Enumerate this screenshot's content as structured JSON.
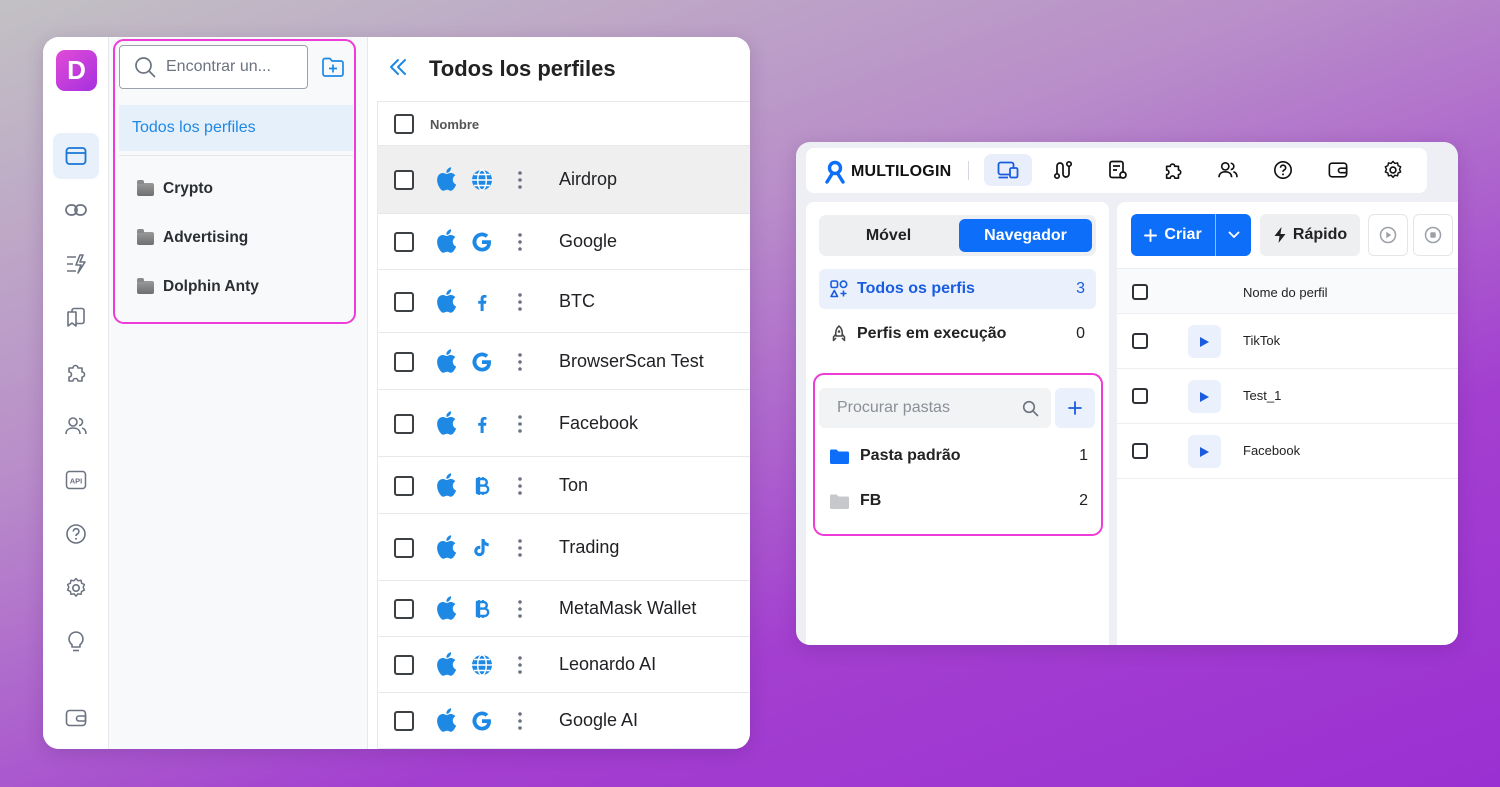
{
  "dolphin": {
    "logo_letter": "D",
    "search_placeholder": "Encontrar un...",
    "all_profiles_label": "Todos los perfiles",
    "folders": [
      "Crypto",
      "Advertising",
      "Dolphin Anty"
    ],
    "page_title": "Todos los perfiles",
    "column_name": "Nombre",
    "profiles": [
      {
        "name": "Airdrop",
        "site_icon": "globe-icon",
        "selected": true
      },
      {
        "name": "Google",
        "site_icon": "google-icon",
        "selected": false
      },
      {
        "name": "BTC",
        "site_icon": "facebook-icon",
        "selected": false
      },
      {
        "name": "BrowserScan Test",
        "site_icon": "google-icon",
        "selected": false
      },
      {
        "name": "Facebook",
        "site_icon": "facebook-icon",
        "selected": false
      },
      {
        "name": "Ton",
        "site_icon": "bitcoin-icon",
        "selected": false
      },
      {
        "name": "Trading",
        "site_icon": "tiktok-icon",
        "selected": false
      },
      {
        "name": "MetaMask Wallet",
        "site_icon": "bitcoin-icon",
        "selected": false
      },
      {
        "name": "Leonardo AI",
        "site_icon": "globe-icon",
        "selected": false
      },
      {
        "name": "Google AI",
        "site_icon": "google-icon",
        "selected": false
      }
    ],
    "rail_icons": [
      "browser-profiles-icon",
      "link-icon",
      "automation-icon",
      "bookmarks-icon",
      "extensions-icon",
      "team-icon",
      "api-icon",
      "help-icon",
      "settings-icon",
      "tips-icon",
      "wallet-icon"
    ],
    "rail_api_label": "API",
    "accent_color": "#1e88e5",
    "highlight_color": "#ee3cd8"
  },
  "multilogin": {
    "logo_text": "MULTILOGIN",
    "top_tabs": [
      "profiles-icon",
      "automation-icon",
      "proxy-icon",
      "extensions-icon",
      "team-icon",
      "help-icon",
      "wallet-icon",
      "settings-icon"
    ],
    "segment_mobile": "Móvel",
    "segment_browser": "Navegador",
    "nav_all_profiles": "Todos os perfis",
    "nav_all_count": "3",
    "nav_running": "Perfis em execução",
    "nav_running_count": "0",
    "folder_search_placeholder": "Procurar pastas",
    "folders": [
      {
        "name": "Pasta padrão",
        "count": "1",
        "color": "#0d6ef9"
      },
      {
        "name": "FB",
        "count": "2",
        "color": "#c6c8cc"
      }
    ],
    "create_label": "Criar",
    "quick_label": "Rápido",
    "column_profile_name": "Nome do perfil",
    "profiles": [
      "TikTok",
      "Test_1",
      "Facebook"
    ],
    "accent_color": "#0d6ef9"
  }
}
